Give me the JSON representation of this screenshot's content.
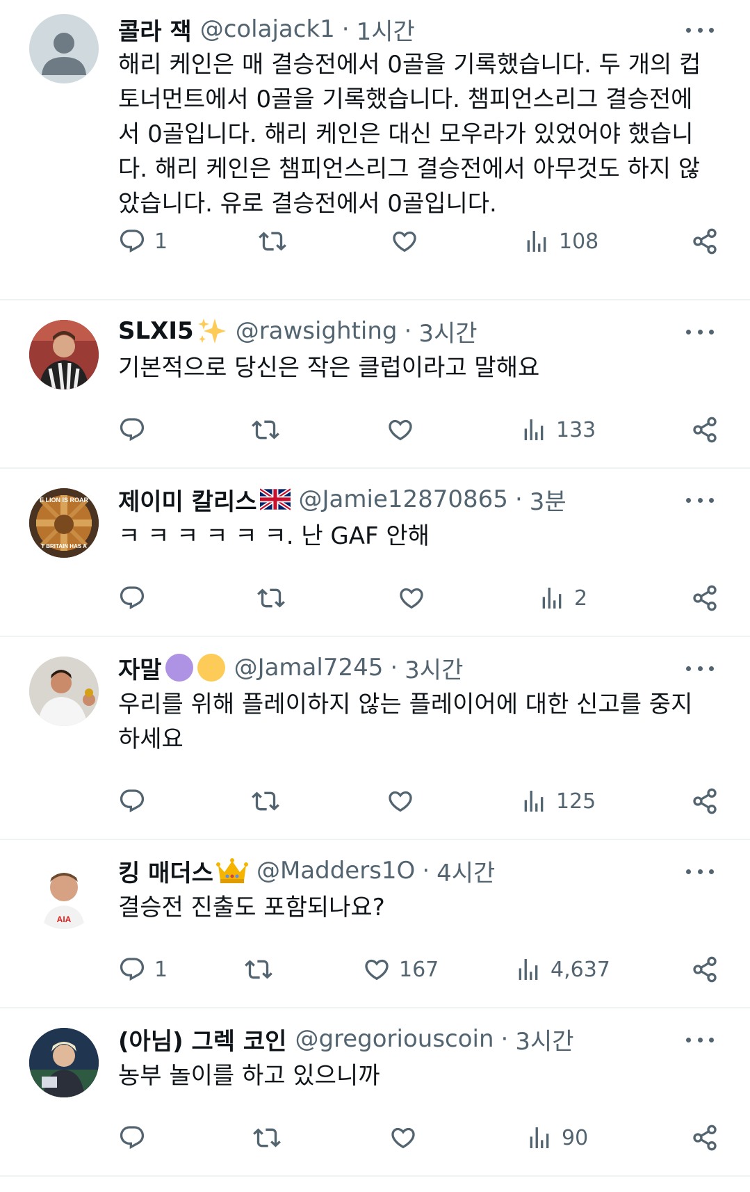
{
  "tweets": [
    {
      "name": "콜라 잭",
      "handle": "@colajack1",
      "time": "1시간",
      "lines": [
        "해리 케인은 매 결승전에서 0골을 기록했습니다. 두 개의 컵",
        "토너먼트에서 0골을 기록했습니다. 챔피언스리그 결승전에",
        "서 0골입니다. 해리 케인은 대신 모우라가 있었어야 했습니",
        "다. 해리 케인은 챔피언스리그 결승전에서 아무것도 하지 않",
        "았습니다. 유로 결승전에서 0골입니다."
      ],
      "replies": "1",
      "retweets": "",
      "likes": "",
      "views": "108"
    },
    {
      "name": "SLXI5",
      "handle": "@rawsighting",
      "time": "3시간",
      "lines": [
        "기본적으로 당신은 작은 클럽이라고 말해요"
      ],
      "replies": "",
      "retweets": "",
      "likes": "",
      "views": "133"
    },
    {
      "name": "제이미 칼리스",
      "handle": "@Jamie12870865",
      "time": "3분",
      "lines": [
        "ㅋ ㅋ ㅋ ㅋ ㅋ ㅋ. 난 GAF 안해"
      ],
      "replies": "",
      "retweets": "",
      "likes": "",
      "views": "2"
    },
    {
      "name": "자말",
      "handle": "@Jamal7245",
      "time": "3시간",
      "lines": [
        "우리를 위해 플레이하지 않는 플레이어에 대한 신고를 중지",
        "하세요"
      ],
      "replies": "",
      "retweets": "",
      "likes": "",
      "views": "125"
    },
    {
      "name": "킹 매더스",
      "handle": "@Madders1O",
      "time": "4시간",
      "lines": [
        "결승전 진출도 포함되나요?"
      ],
      "replies": "1",
      "retweets": "",
      "likes": "167",
      "views": "4,637"
    },
    {
      "name": "(아님) 그렉 코인",
      "handle": "@gregoriouscoin",
      "time": "3시간",
      "lines": [
        "농부 놀이를 하고 있으니까"
      ],
      "replies": "",
      "retweets": "",
      "likes": "",
      "views": "90"
    }
  ],
  "avatar_text": {
    "jamie_line1": "E LION IS ROAR",
    "jamie_line2": "T BRITAIN HAS A",
    "madders_shirt": "AIA"
  },
  "colors": {
    "text": "#0f1419",
    "secondary": "#536471",
    "divider": "#eff3f4",
    "purple_circle": "#ae92e4",
    "yellow_circle": "#fdcb58"
  },
  "icons": {
    "reply": "reply-icon",
    "retweet": "retweet-icon",
    "like": "heart-icon",
    "views": "views-icon",
    "share": "share-icon",
    "more": "more-icon"
  }
}
